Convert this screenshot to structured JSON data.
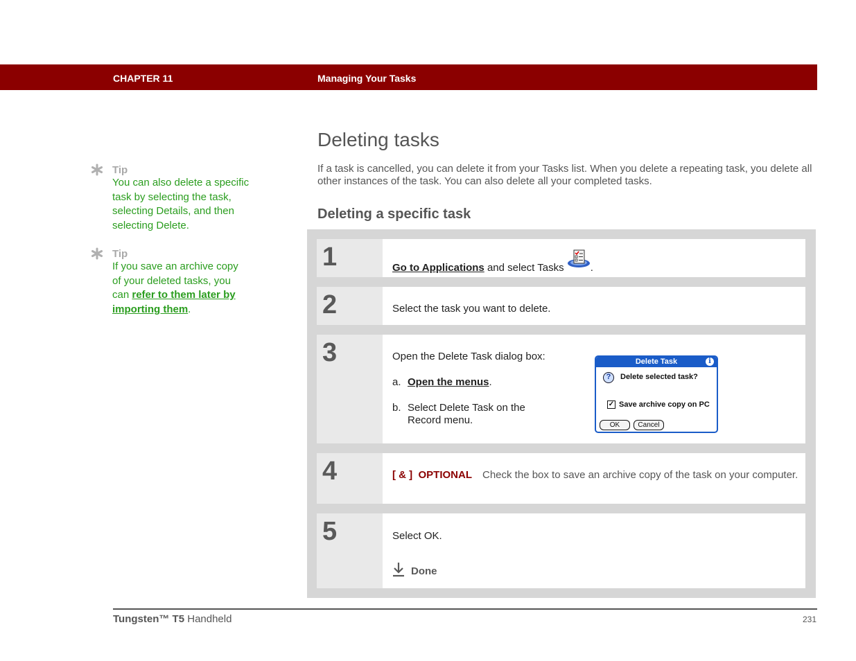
{
  "header": {
    "chapter": "CHAPTER 11",
    "title": "Managing Your Tasks",
    "color": "#8b0000"
  },
  "sidebar": {
    "tips": [
      {
        "label": "Tip",
        "icon": "asterisk-icon",
        "text": "You can also delete a specific task by selecting the task, selecting Details, and then selecting Delete."
      },
      {
        "label": "Tip",
        "icon": "asterisk-icon",
        "text_before": "If you save an archive copy of your deleted tasks, you can ",
        "link": "refer to them later by importing them",
        "text_after": "."
      }
    ]
  },
  "main": {
    "title": "Deleting tasks",
    "intro": "If a task is cancelled, you can delete it from your Tasks list. When you delete a repeating task, you delete all other instances of the task. You can also delete all your completed tasks.",
    "section_title": "Deleting a specific task",
    "steps": [
      {
        "number": "1",
        "link": "Go to Applications",
        "text": " and select Tasks ",
        "icon": "tasks-app-icon",
        "after": "."
      },
      {
        "number": "2",
        "text": "Select the task you want to delete."
      },
      {
        "number": "3",
        "text": "Open the Delete Task dialog box:",
        "substeps": [
          {
            "marker": "a.",
            "link": "Open the menus",
            "after": "."
          },
          {
            "marker": "b.",
            "text": "Select Delete Task on the Record menu."
          }
        ],
        "dialog": {
          "title": "Delete Task",
          "message": "Delete selected task?",
          "checkbox_label": "Save archive copy on PC",
          "checkbox_checked": true,
          "buttons": [
            "OK",
            "Cancel"
          ]
        }
      },
      {
        "number": "4",
        "optional_tag": "[ & ]  OPTIONAL",
        "text": "Check the box to save an archive copy of the task on your computer."
      },
      {
        "number": "5",
        "text": "Select OK.",
        "done_label": "Done"
      }
    ]
  },
  "footer": {
    "product_bold": "Tungsten™ T5",
    "product_rest": " Handheld",
    "page_number": "231"
  }
}
